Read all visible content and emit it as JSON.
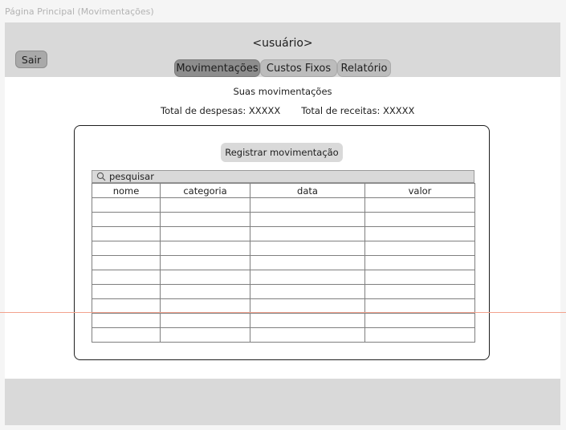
{
  "frame_label": "Página Principal (Movimentações)",
  "header": {
    "user": "<usuário>",
    "logout_label": "Sair",
    "tabs": [
      {
        "label": "Movimentações",
        "active": true
      },
      {
        "label": "Custos Fixos",
        "active": false
      },
      {
        "label": "Relatório",
        "active": false
      }
    ]
  },
  "main": {
    "subtitle": "Suas movimentações",
    "total_expenses": "Total de despesas: XXXXX",
    "total_income": "Total de receitas: XXXXX",
    "register_button": "Registrar movimentação",
    "search": {
      "placeholder": "pesquisar",
      "icon": "search-icon"
    },
    "table": {
      "columns": [
        "nome",
        "categoria",
        "data",
        "valor"
      ],
      "row_count": 10
    }
  },
  "colors": {
    "header_bg": "#d9d9d9",
    "tab_active": "#8d8d8d",
    "tab_inactive": "#bcbcbc",
    "guide_line": "#f3a28d"
  }
}
